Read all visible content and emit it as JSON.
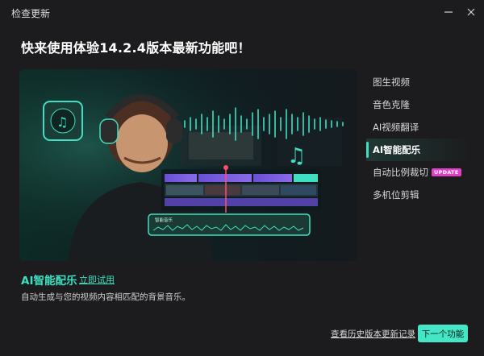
{
  "window": {
    "title": "检查更新"
  },
  "headline": "快来使用体验14.2.4版本最新功能吧！",
  "features": [
    {
      "label": "图生视频",
      "active": false,
      "badge": ""
    },
    {
      "label": "音色克隆",
      "active": false,
      "badge": ""
    },
    {
      "label": "AI视频翻译",
      "active": false,
      "badge": ""
    },
    {
      "label": "AI智能配乐",
      "active": true,
      "badge": ""
    },
    {
      "label": "自动比例裁切",
      "active": false,
      "badge": "UPDATE"
    },
    {
      "label": "多机位剪辑",
      "active": false,
      "badge": ""
    }
  ],
  "current_feature": {
    "title": "AI智能配乐",
    "try_label": "立即试用",
    "description": "自动生成与您的视频内容相匹配的背景音乐。"
  },
  "hero": {
    "audio_clip_label": "智能音乐"
  },
  "footer": {
    "history_link": "查看历史版本更新记录",
    "next_button": "下一个功能"
  },
  "colors": {
    "accent": "#44e6c6",
    "badge": "#e040c8",
    "background": "#1c1c1e"
  }
}
